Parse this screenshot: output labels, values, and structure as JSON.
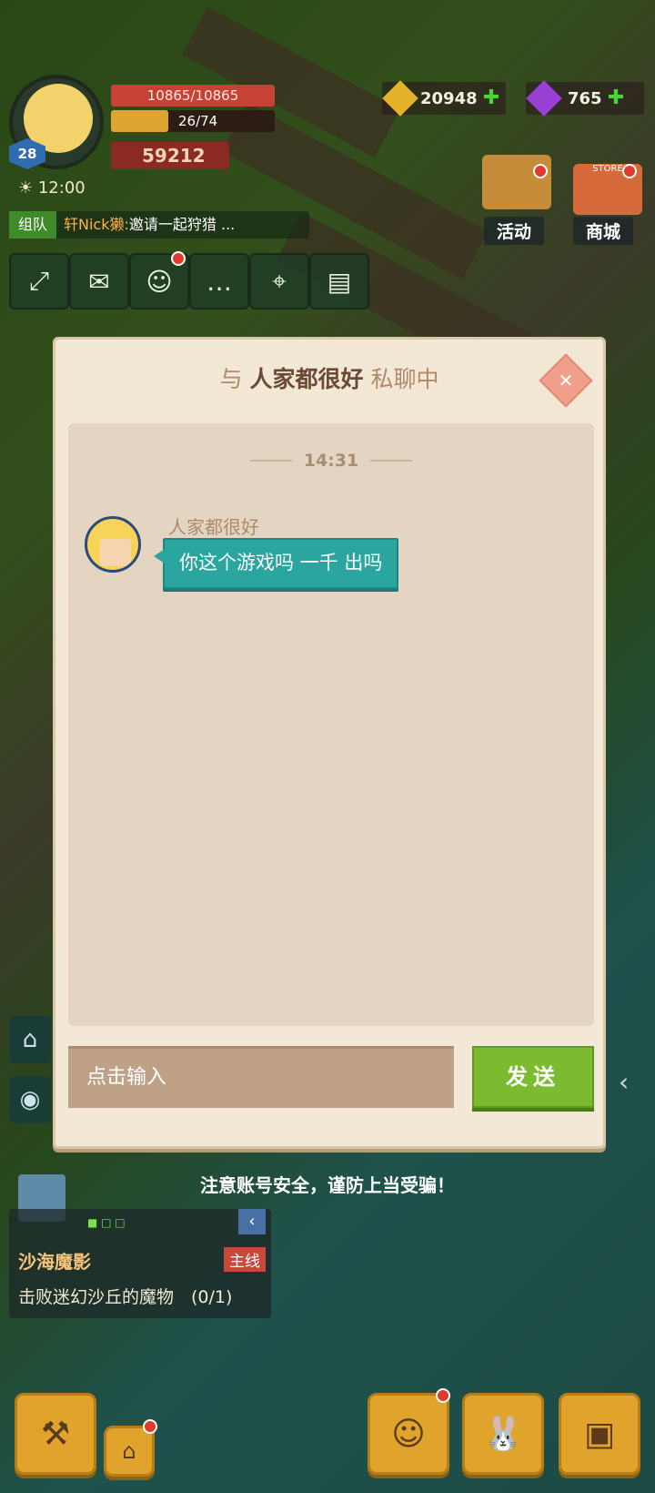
{
  "hud": {
    "level": "28",
    "hp": "10865/10865",
    "xp": "26/74",
    "xp_fraction": 0.35,
    "power": "59212",
    "time": "12:00",
    "team_chat": {
      "tag": "组队",
      "name": "轩Nick獭:",
      "message": "邀请一起狩猎 ..."
    },
    "gold": "20948",
    "gems": "765",
    "activity_label": "活动",
    "store_label": "商城",
    "store_sign": "STORE"
  },
  "dialog": {
    "title_prefix": "与",
    "title_name": "人家都很好",
    "title_suffix": "私聊中",
    "timestamp": "14:31",
    "messages": [
      {
        "sender": "人家都很好",
        "text": "你这个游戏吗 一千 出吗"
      }
    ],
    "input_placeholder": "点击输入",
    "send_label": "发送"
  },
  "warning": "注意账号安全，谨防上当受骗！",
  "quest": {
    "title": "沙海魔影",
    "tag": "主线",
    "desc": "击败迷幻沙丘的魔物　(0/1)"
  },
  "colors": {
    "accent_teal": "#2aa5a0",
    "send_green": "#7cbb2f",
    "hp_red": "#c64234"
  }
}
